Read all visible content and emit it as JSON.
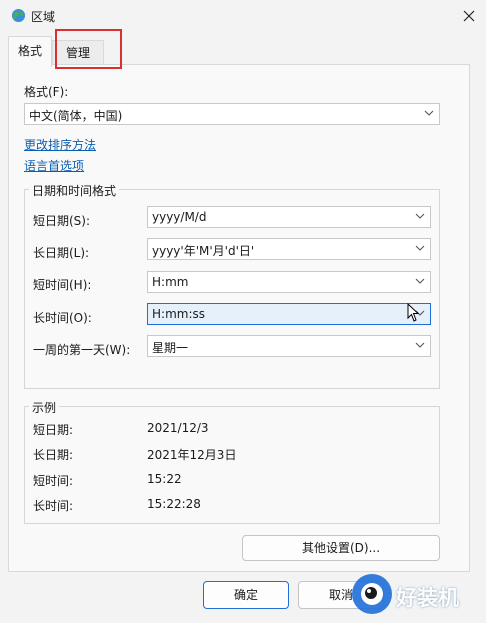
{
  "window": {
    "title": "区域"
  },
  "tabs": [
    {
      "label": "格式"
    },
    {
      "label": "管理"
    }
  ],
  "format": {
    "label": "格式(F):",
    "selected": "中文(简体，中国)"
  },
  "links": {
    "sort": "更改排序方法",
    "language": "语言首选项"
  },
  "datetime": {
    "title": "日期和时间格式",
    "rows": [
      {
        "label": "短日期(S):",
        "value": "yyyy/M/d"
      },
      {
        "label": "长日期(L):",
        "value": "yyyy'年'M'月'd'日'"
      },
      {
        "label": "短时间(H):",
        "value": "H:mm"
      },
      {
        "label": "长时间(O):",
        "value": "H:mm:ss"
      },
      {
        "label": "一周的第一天(W):",
        "value": "星期一"
      }
    ]
  },
  "examples": {
    "title": "示例",
    "rows": [
      {
        "label": "短日期:",
        "value": "2021/12/3"
      },
      {
        "label": "长日期:",
        "value": "2021年12月3日"
      },
      {
        "label": "短时间:",
        "value": "15:22"
      },
      {
        "label": "长时间:",
        "value": "15:22:28"
      }
    ]
  },
  "buttons": {
    "more": "其他设置(D)...",
    "ok": "确定",
    "cancel": "取消"
  },
  "watermark": {
    "text": "好装机"
  },
  "colors": {
    "accent": "#1e6fd9",
    "highlight": "#d9302f",
    "link": "#0b5fb0"
  }
}
